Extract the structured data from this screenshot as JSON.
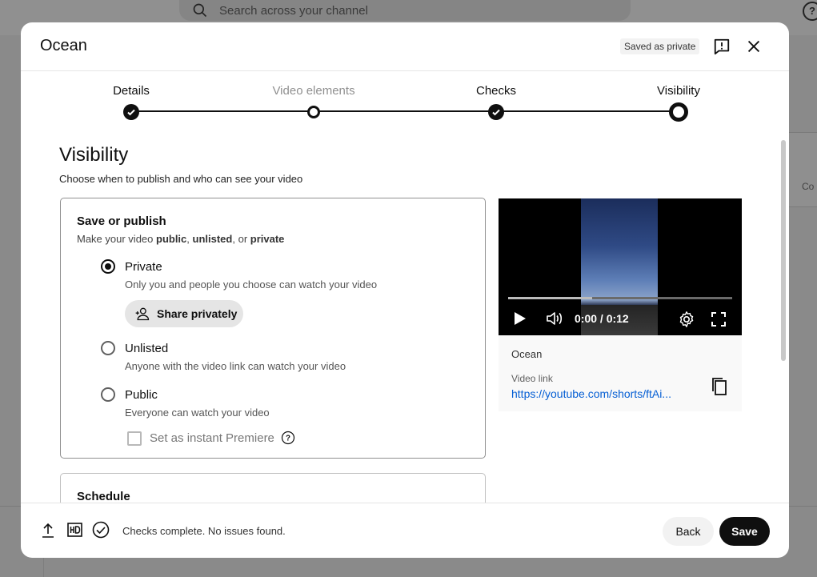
{
  "background": {
    "search_placeholder": "Search across your channel",
    "help_glyph": "?",
    "right_panel_text": "Co"
  },
  "dialog": {
    "title": "Ocean",
    "saved_badge": "Saved as private",
    "icons": {
      "feedback": "feedback-icon",
      "close": "close-icon"
    }
  },
  "stepper": {
    "steps": [
      {
        "label": "Details",
        "state": "done"
      },
      {
        "label": "Video elements",
        "state": "todo"
      },
      {
        "label": "Checks",
        "state": "done"
      },
      {
        "label": "Visibility",
        "state": "current"
      }
    ]
  },
  "visibility": {
    "heading": "Visibility",
    "subheading": "Choose when to publish and who can see your video",
    "save_or_publish": {
      "title": "Save or publish",
      "desc_prefix": "Make your video ",
      "desc_public": "public",
      "desc_sep1": ", ",
      "desc_unlisted": "unlisted",
      "desc_sep2": ", or ",
      "desc_private": "private"
    },
    "options": [
      {
        "label": "Private",
        "desc": "Only you and people you choose can watch your video",
        "selected": true
      },
      {
        "label": "Unlisted",
        "desc": "Anyone with the video link can watch your video",
        "selected": false
      },
      {
        "label": "Public",
        "desc": "Everyone can watch your video",
        "selected": false
      }
    ],
    "share_button": "Share privately",
    "premiere": {
      "label": "Set as instant Premiere",
      "checked": false,
      "help_glyph": "?"
    },
    "schedule": {
      "title": "Schedule"
    }
  },
  "preview": {
    "time": "0:00 / 0:12",
    "progress_buffered_fraction": 0.375,
    "title": "Ocean",
    "link_label": "Video link",
    "link": "https://youtube.com/shorts/ftAi..."
  },
  "footer": {
    "status": "Checks complete. No issues found.",
    "back": "Back",
    "save": "Save"
  },
  "colors": {
    "accent": "#0f0f0f",
    "link": "#065fd4",
    "badge_bg": "#f2f2f2"
  }
}
